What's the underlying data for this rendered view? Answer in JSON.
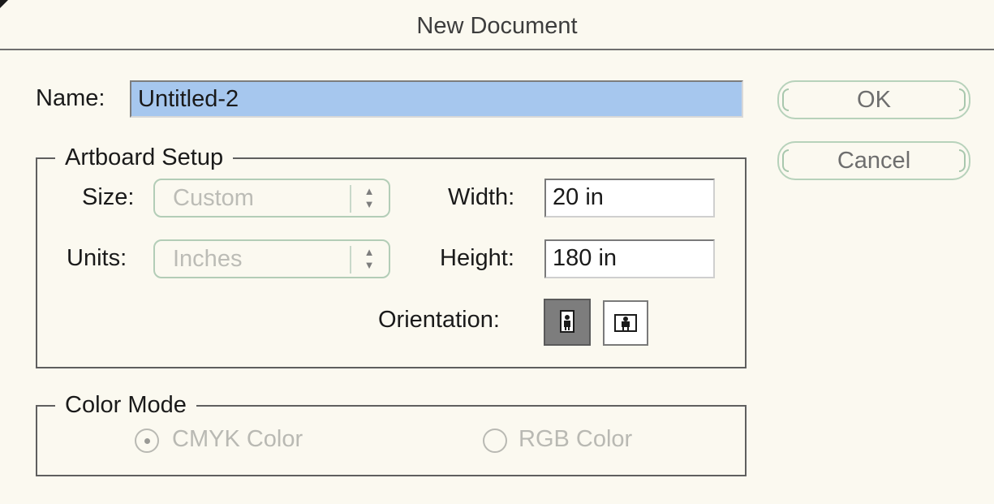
{
  "dialog": {
    "title": "New Document"
  },
  "name_field": {
    "label": "Name:",
    "value": "Untitled-2"
  },
  "artboard": {
    "group_title": "Artboard Setup",
    "size_label": "Size:",
    "size_value": "Custom",
    "units_label": "Units:",
    "units_value": "Inches",
    "width_label": "Width:",
    "width_value": "20 in",
    "height_label": "Height:",
    "height_value": "180 in",
    "orientation_label": "Orientation:",
    "orientation_selected": "portrait",
    "orientation_icons": [
      "portrait-icon",
      "landscape-icon"
    ]
  },
  "color_mode": {
    "group_title": "Color Mode",
    "options": [
      {
        "label": "CMYK Color",
        "selected": true
      },
      {
        "label": "RGB Color",
        "selected": false
      }
    ],
    "enabled": false
  },
  "buttons": {
    "ok_label": "OK",
    "cancel_label": "Cancel"
  },
  "colors": {
    "background": "#fbf9f0",
    "selection_highlight": "#a6c7ee",
    "button_border": "#b7d2bb",
    "disabled_text": "#b9b9b3"
  }
}
